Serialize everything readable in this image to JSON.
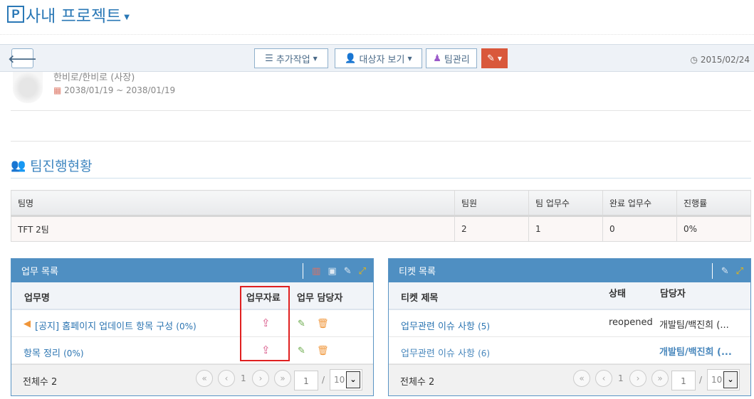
{
  "header": {
    "logo_letter": "P",
    "title": "사내 프로젝트"
  },
  "toolbar": {
    "more_actions": "추가작업",
    "view_target": "대상자 보기",
    "team_manage": "팀관리",
    "date": "2015/02/24"
  },
  "profile": {
    "name": "한비로/한비로 (사장)",
    "period": "2038/01/19 ~ 2038/01/19"
  },
  "team_status": {
    "title": "팀진행현황",
    "headers": [
      "팀명",
      "팀원",
      "팀 업무수",
      "완료 업무수",
      "진행률"
    ],
    "rows": [
      [
        "TFT 2팀",
        "2",
        "1",
        "0",
        "0%"
      ]
    ]
  },
  "task_panel": {
    "title": "업무 목록",
    "headers": [
      "업무명",
      "업무자료",
      "업무 담당자"
    ],
    "rows": [
      {
        "name": "[공지] 홈페이지 업데이트 항목 구성",
        "progress": "(0%)",
        "notice": true
      },
      {
        "name": "항목 정리",
        "progress": "(0%)",
        "notice": false
      }
    ],
    "total": "전체수 2",
    "page": "1",
    "page_input": "1",
    "page_size": "10",
    "sep": "/"
  },
  "ticket_panel": {
    "title": "티켓 목록",
    "headers": [
      "티켓 제목",
      "상태",
      "담당자"
    ],
    "rows": [
      {
        "title": "업무관련 이슈 사항",
        "count": "(5)",
        "status": "reopened",
        "assignee": "개발팀/백진희 (..."
      },
      {
        "title": "업무관련 이슈 사항",
        "count": "(6)",
        "status": "",
        "assignee": "개발팀/백진희 (..."
      }
    ],
    "total": "전체수 2",
    "page": "1",
    "page_input": "1",
    "page_size": "10",
    "sep": "/"
  },
  "colors": {
    "accent": "#4f8fc2",
    "danger": "#d9583b",
    "upload": "#d9598a",
    "edit": "#6aaa4b",
    "delete": "#f0963a",
    "highlight": "#e02020"
  }
}
